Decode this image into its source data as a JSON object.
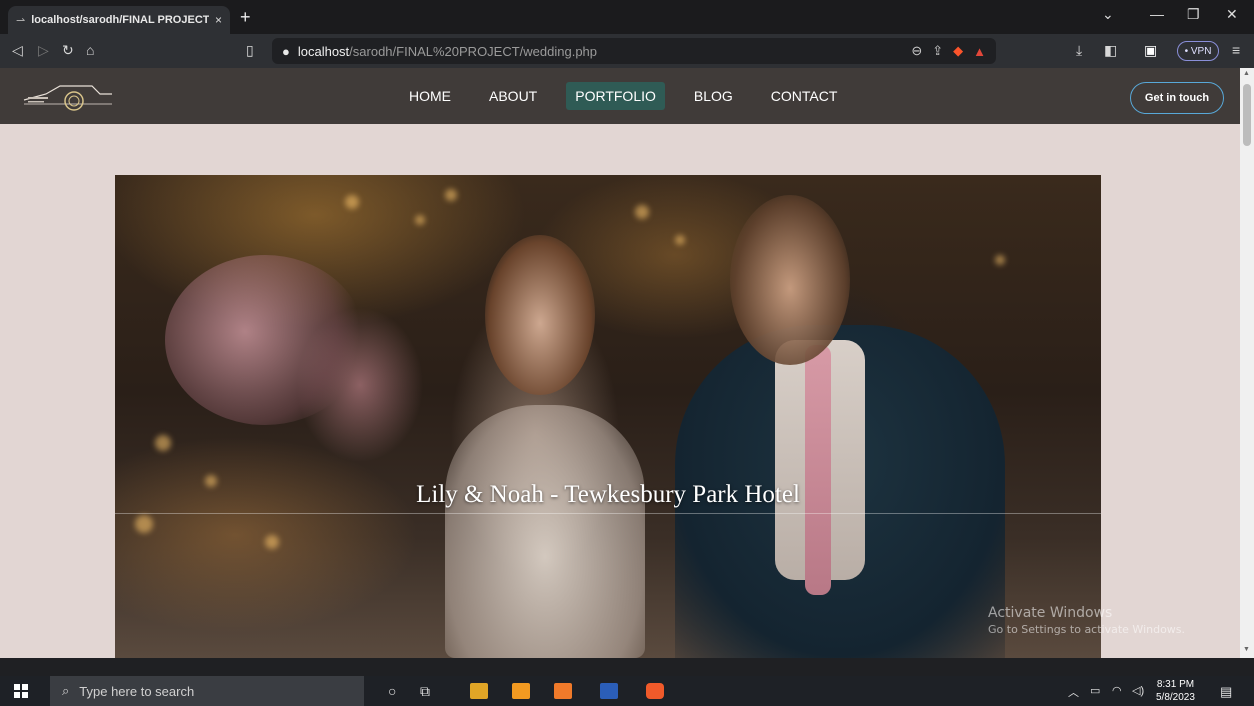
{
  "browser": {
    "tab_title": "localhost/sarodh/FINAL PROJECT",
    "tab_close": "×",
    "new_tab": "+",
    "url_host": "localhost",
    "url_path": "/sarodh/FINAL%20PROJECT/wedding.php",
    "vpn_label": "• VPN",
    "accent": "#8a8fd9"
  },
  "site": {
    "nav": [
      "HOME",
      "ABOUT",
      "PORTFOLIO",
      "BLOG",
      "CONTACT"
    ],
    "active_nav": "PORTFOLIO",
    "cta": "Get in touch",
    "navbar_color": "#403b39",
    "page_bg": "#e2d6d3",
    "active_color": "#2f5b55"
  },
  "hero": {
    "caption": "Lily & Noah - Tewkesbury Park Hotel"
  },
  "watermark": {
    "line1": "Activate Windows",
    "line2": "Go to Settings to activate Windows."
  },
  "taskbar": {
    "search_placeholder": "Type here to search",
    "time": "8:31 PM",
    "date": "5/8/2023"
  }
}
